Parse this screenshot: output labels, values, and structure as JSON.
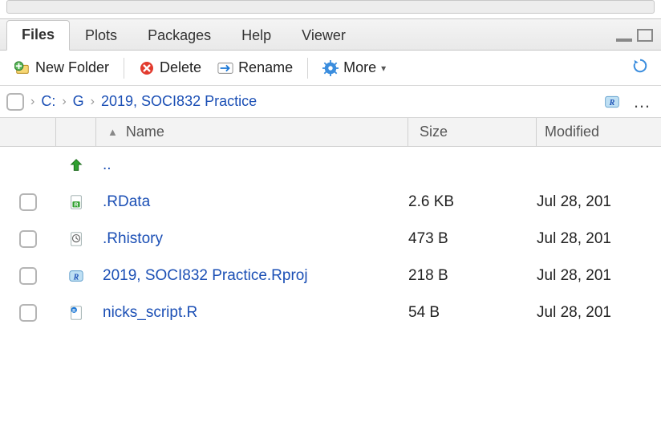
{
  "tabs": {
    "files": "Files",
    "plots": "Plots",
    "packages": "Packages",
    "help": "Help",
    "viewer": "Viewer"
  },
  "toolbar": {
    "new_folder": "New Folder",
    "delete": "Delete",
    "rename": "Rename",
    "more": "More"
  },
  "breadcrumb": {
    "parts": {
      "drive": "C:",
      "folder1": "G",
      "folder2": "2019, SOCI832 Practice"
    }
  },
  "columns": {
    "name": "Name",
    "size": "Size",
    "modified": "Modified"
  },
  "parent_dir": "..",
  "files": [
    {
      "name": ".RData",
      "size": "2.6 KB",
      "modified": "Jul 28, 201",
      "icon": "rdata"
    },
    {
      "name": ".Rhistory",
      "size": "473 B",
      "modified": "Jul 28, 201",
      "icon": "history"
    },
    {
      "name": "2019, SOCI832 Practice.Rproj",
      "size": "218 B",
      "modified": "Jul 28, 201",
      "icon": "rproj"
    },
    {
      "name": "nicks_script.R",
      "size": "54 B",
      "modified": "Jul 28, 201",
      "icon": "rscript"
    }
  ]
}
